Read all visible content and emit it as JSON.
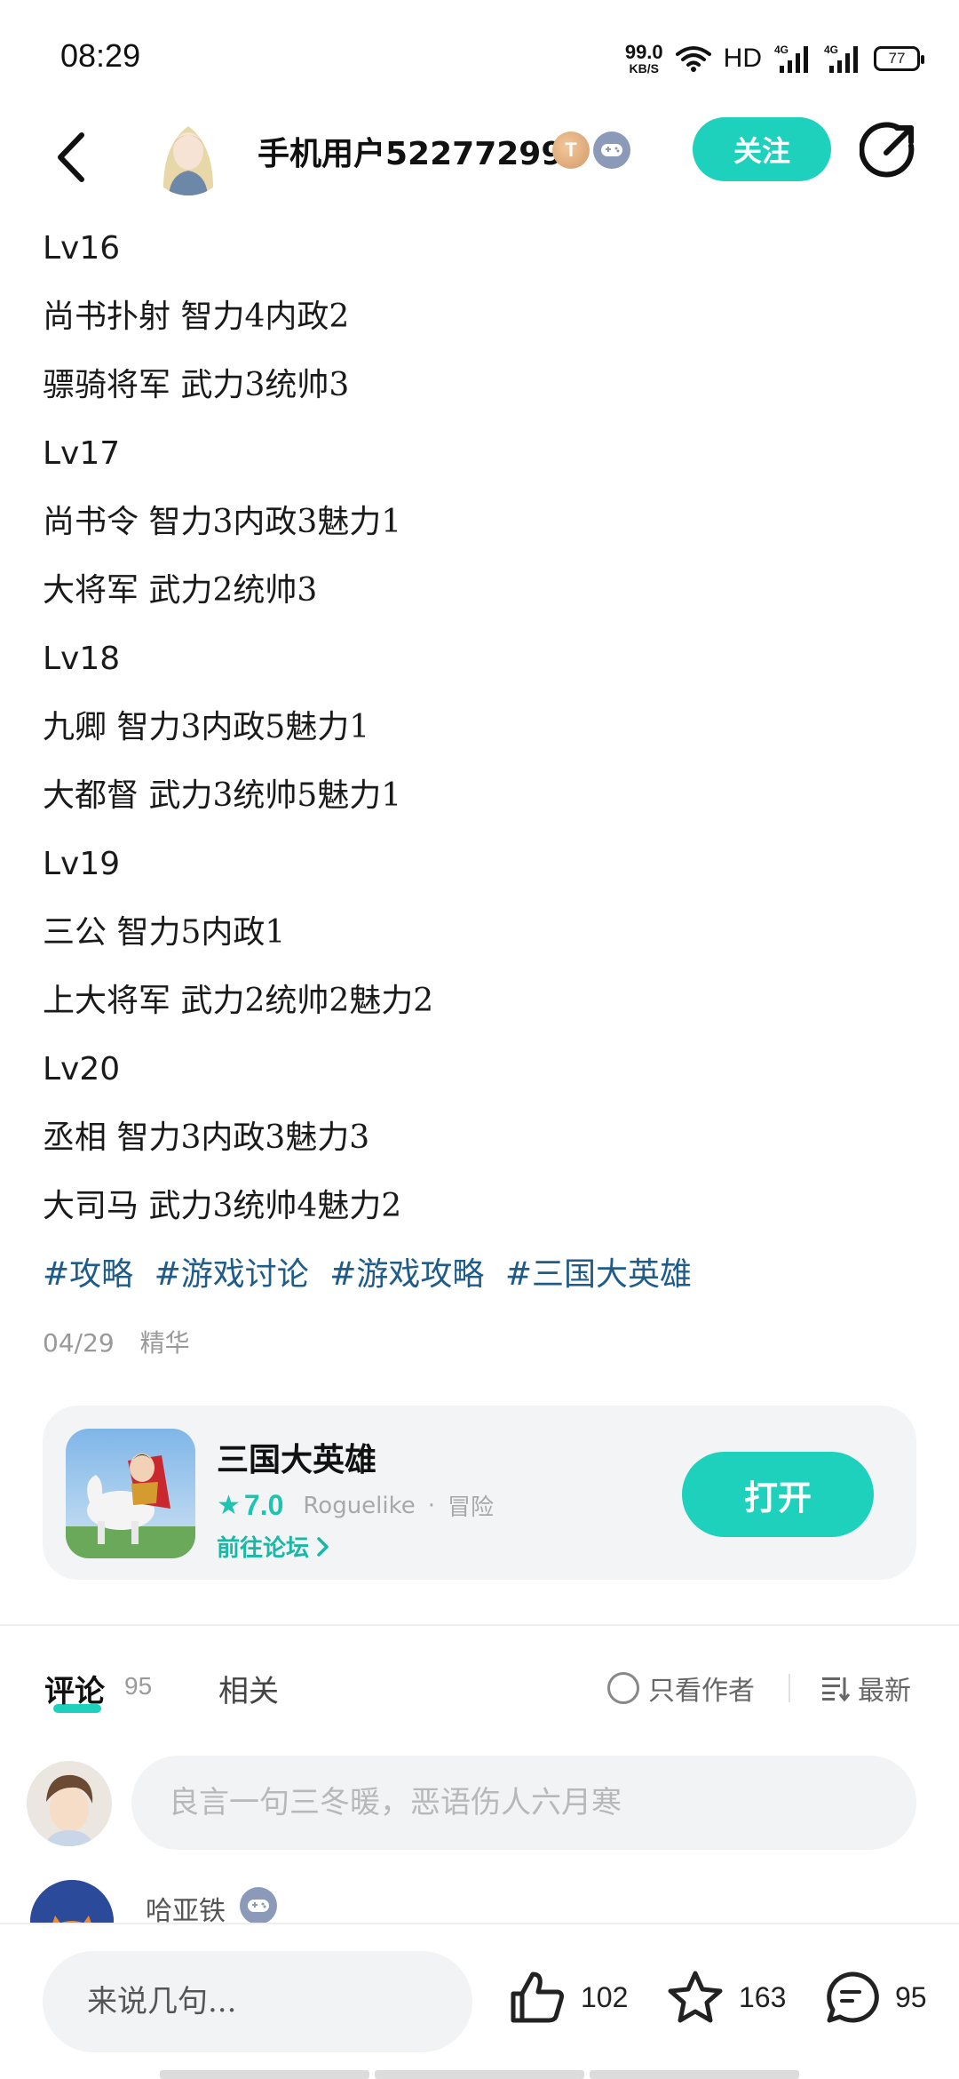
{
  "status_bar": {
    "time": "08:29",
    "net_speed_value": "99.0",
    "net_speed_unit": "KB/S",
    "hd_label": "HD",
    "battery": "77",
    "icons": [
      "wifi-icon",
      "signal-4g-icon",
      "signal-4g-icon",
      "battery-icon"
    ]
  },
  "header": {
    "username": "手机用户52277299",
    "badge_level": "T",
    "follow_label": "关注",
    "icons": [
      "back-arrow-icon",
      "gamepad-icon",
      "share-icon"
    ]
  },
  "article": {
    "lines": [
      {
        "text": "Lv16",
        "kind": "level"
      },
      {
        "text": "尚书扑射 智力4内政2",
        "kind": "text"
      },
      {
        "text": "骠骑将军 武力3统帅3",
        "kind": "text"
      },
      {
        "text": "Lv17",
        "kind": "level"
      },
      {
        "text": "尚书令 智力3内政3魅力1",
        "kind": "text"
      },
      {
        "text": "大将军 武力2统帅3",
        "kind": "text"
      },
      {
        "text": "Lv18",
        "kind": "level"
      },
      {
        "text": "九卿 智力3内政5魅力1",
        "kind": "text"
      },
      {
        "text": "大都督 武力3统帅5魅力1",
        "kind": "text"
      },
      {
        "text": "Lv19",
        "kind": "level"
      },
      {
        "text": "三公 智力5内政1",
        "kind": "text"
      },
      {
        "text": "上大将军 武力2统帅2魅力2",
        "kind": "text"
      },
      {
        "text": "Lv20",
        "kind": "level"
      },
      {
        "text": "丞相 智力3内政3魅力3",
        "kind": "text"
      },
      {
        "text": "大司马 武力3统帅4魅力2",
        "kind": "text"
      }
    ],
    "tags": [
      "#攻略",
      "#游戏讨论",
      "#游戏攻略",
      "#三国大英雄"
    ],
    "date": "04/29",
    "essence_label": "精华"
  },
  "game_card": {
    "name": "三国大英雄",
    "score": "7.0",
    "genre1": "Roguelike",
    "genre2": "冒险",
    "forum_link": "前往论坛",
    "open_label": "打开"
  },
  "comments": {
    "tab_label": "评论",
    "count": "95",
    "related_label": "相关",
    "only_author_label": "只看作者",
    "sort_label": "最新",
    "input_placeholder": "良言一句三冬暖，恶语伤人六月寒",
    "first_commenter": "哈亚铁"
  },
  "bottom_bar": {
    "input_placeholder": "来说几句...",
    "likes": "102",
    "favorites": "163",
    "comments": "95"
  },
  "colors": {
    "accent": "#1dd1bc",
    "tag": "#1f5c8a",
    "muted": "#999999"
  }
}
